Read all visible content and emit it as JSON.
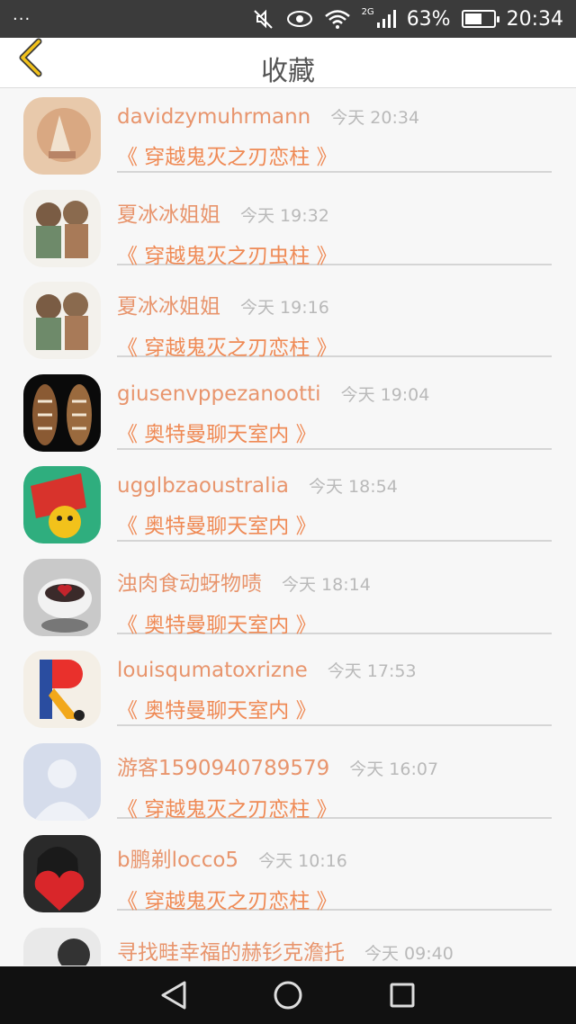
{
  "status_bar": {
    "dots": "···",
    "battery_text": "63%",
    "battery_level": 0.63,
    "network": "2G",
    "time": "20:34"
  },
  "header": {
    "title": "收藏"
  },
  "items": [
    {
      "name": "davidzymuhrmann",
      "time": "今天 20:34",
      "room": "《 穿越鬼灭之刃恋柱 》"
    },
    {
      "name": "夏冰冰姐姐",
      "time": "今天 19:32",
      "room": "《 穿越鬼灭之刃虫柱 》"
    },
    {
      "name": "夏冰冰姐姐",
      "time": "今天 19:16",
      "room": "《 穿越鬼灭之刃恋柱 》"
    },
    {
      "name": "giusenvppezanootti",
      "time": "今天 19:04",
      "room": "《 奥特曼聊天室内 》"
    },
    {
      "name": "ugglbzaoustralia",
      "time": "今天 18:54",
      "room": "《 奥特曼聊天室内 》"
    },
    {
      "name": "浊肉食动蚜物啧",
      "time": "今天 18:14",
      "room": "《 奥特曼聊天室内 》"
    },
    {
      "name": "louisqumatoxrizne",
      "time": "今天 17:53",
      "room": "《 奥特曼聊天室内 》"
    },
    {
      "name": "游客1590940789579",
      "time": "今天 16:07",
      "room": "《 穿越鬼灭之刃恋柱 》"
    },
    {
      "name": "b鹏剃locco5",
      "time": "今天 10:16",
      "room": "《 穿越鬼灭之刃恋柱 》"
    },
    {
      "name": "寻找畦幸福的赫钐克澹托",
      "time": "今天 09:40",
      "room": ""
    }
  ],
  "colors": {
    "accent_name": "#e8956d",
    "accent_room": "#ef8a55",
    "back_icon": "#f2c21b"
  }
}
